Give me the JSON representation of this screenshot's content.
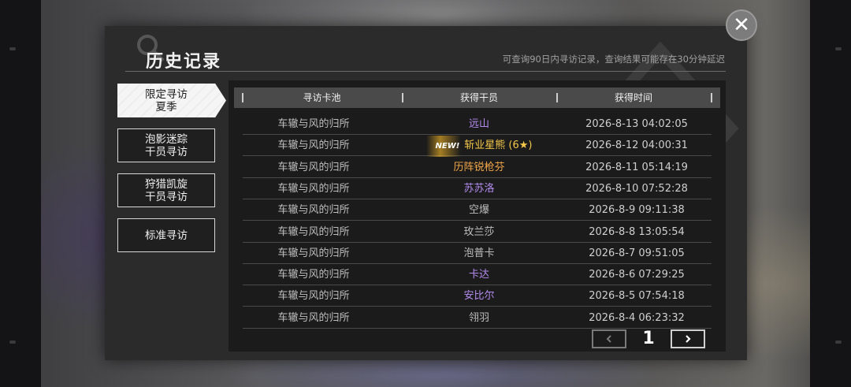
{
  "dialog": {
    "title": "历史记录",
    "notice": "可查询90日内寻访记录，查询结果可能存在30分钟延迟",
    "close_glyph": "✕"
  },
  "tabs": [
    {
      "label": "限定寻访\n夏季",
      "active": true
    },
    {
      "label": "泡影迷踪\n干员寻访",
      "active": false
    },
    {
      "label": "狩猎凯旋\n干员寻访",
      "active": false
    },
    {
      "label": "标准寻访",
      "active": false
    }
  ],
  "table": {
    "headers": [
      "寻访卡池",
      "获得干员",
      "获得时间"
    ],
    "rows": [
      {
        "pool": "车辙与风的归所",
        "operator": "远山",
        "time": "2026-8-13 04:02:05",
        "color": "#b48cf0",
        "new": ""
      },
      {
        "pool": "车辙与风的归所",
        "operator": "斩业星熊 (6★)",
        "time": "2026-8-12 04:00:31",
        "color": "#f5c84a",
        "new": "NEW!"
      },
      {
        "pool": "车辙与风的归所",
        "operator": "历阵锐枪芬",
        "time": "2026-8-11 05:14:19",
        "color": "#f5a84a",
        "new": ""
      },
      {
        "pool": "车辙与风的归所",
        "operator": "苏苏洛",
        "time": "2026-8-10 07:52:28",
        "color": "#b48cf0",
        "new": ""
      },
      {
        "pool": "车辙与风的归所",
        "operator": "空爆",
        "time": "2026-8-9 09:11:38",
        "color": "#bdbdbd",
        "new": ""
      },
      {
        "pool": "车辙与风的归所",
        "operator": "玫兰莎",
        "time": "2026-8-8 13:05:54",
        "color": "#bdbdbd",
        "new": ""
      },
      {
        "pool": "车辙与风的归所",
        "operator": "泡普卡",
        "time": "2026-8-7 09:51:05",
        "color": "#bdbdbd",
        "new": ""
      },
      {
        "pool": "车辙与风的归所",
        "operator": "卡达",
        "time": "2026-8-6 07:29:25",
        "color": "#b48cf0",
        "new": ""
      },
      {
        "pool": "车辙与风的归所",
        "operator": "安比尔",
        "time": "2026-8-5 07:54:18",
        "color": "#b48cf0",
        "new": ""
      },
      {
        "pool": "车辙与风的归所",
        "operator": "翎羽",
        "time": "2026-8-4 06:23:32",
        "color": "#bdbdbd",
        "new": ""
      }
    ]
  },
  "pagination": {
    "current_page": "1",
    "prev_icon": "chevron-left-icon",
    "next_icon": "chevron-right-icon"
  }
}
